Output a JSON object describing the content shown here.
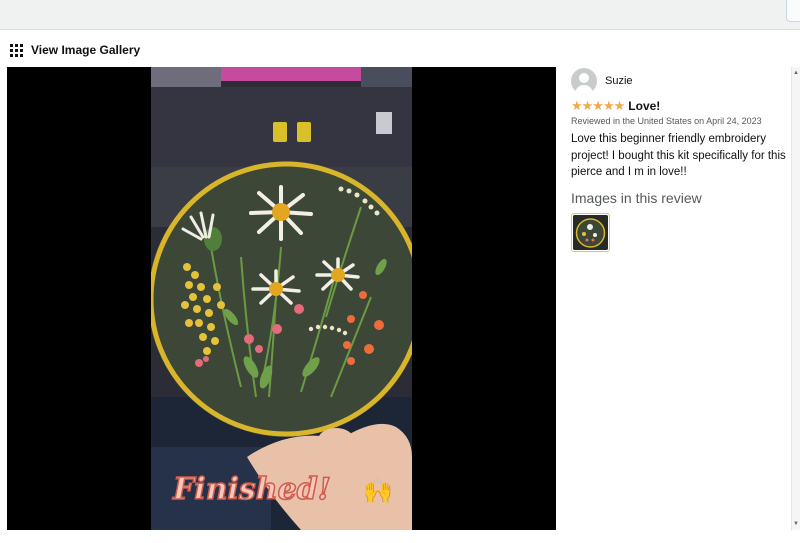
{
  "gallery": {
    "header_label": "View Image Gallery"
  },
  "photo": {
    "caption": "Finished!",
    "caption_emoji": "🙌"
  },
  "review": {
    "reviewer_name": "Suzie",
    "rating": 5,
    "rating_max": 5,
    "stars_text": "★★★★★",
    "title": "Love!",
    "meta": "Reviewed in the United States on April 24, 2023",
    "body": "Love this beginner friendly embroidery project! I bought this kit specifically for this pierce and I m in love!!",
    "images_heading": "Images in this review",
    "image_count": 1
  },
  "scrollbar": {
    "up": "▲",
    "down": "▼"
  },
  "colors": {
    "star": "#f3a847",
    "hoop": "#d9b62a",
    "fabric": "#3f4a39"
  }
}
